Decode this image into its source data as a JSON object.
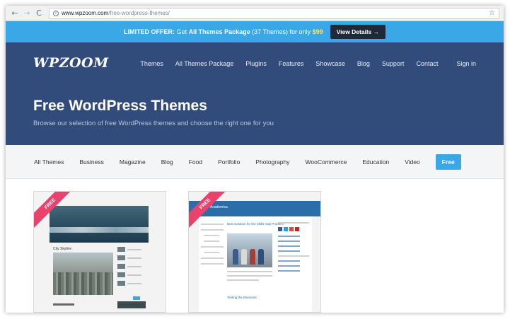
{
  "browser": {
    "back": "←",
    "forward": "→",
    "reload": "C",
    "url_host": "www.wpzoom.com",
    "url_path": "/free-wordpress-themes/",
    "star": "☆"
  },
  "offer": {
    "prefix": "LIMITED OFFER:",
    "text1": "Get",
    "bold": "All Themes Package",
    "text2": "(37 Themes) for only",
    "price": "$99",
    "cta": "View Details →"
  },
  "header": {
    "logo": "WPZOOM",
    "nav": [
      "Themes",
      "All Themes Package",
      "Plugins",
      "Features",
      "Showcase",
      "Blog",
      "Support",
      "Contact"
    ],
    "signin": "Sign in"
  },
  "hero": {
    "title": "Free WordPress Themes",
    "subtitle": "Browse our selection of free WordPress themes and choose the right one for you"
  },
  "filters": {
    "items": [
      "All Themes",
      "Business",
      "Magazine",
      "Blog",
      "Food",
      "Portfolio",
      "Photography",
      "WooCommerce",
      "Education",
      "Video"
    ],
    "active": "Free"
  },
  "cards": [
    {
      "ribbon": "FREE",
      "post_title": "City Skyline"
    },
    {
      "ribbon": "FREE",
      "header_title": "Academica",
      "post_title": "Best Solution for the Skills Gap Problem",
      "sub_title": "Testing the Elements"
    }
  ],
  "colors": {
    "accent": "#3aa7e6",
    "hero": "#314b7a",
    "ribbon": "#e8426d",
    "cta": "#20293a"
  }
}
